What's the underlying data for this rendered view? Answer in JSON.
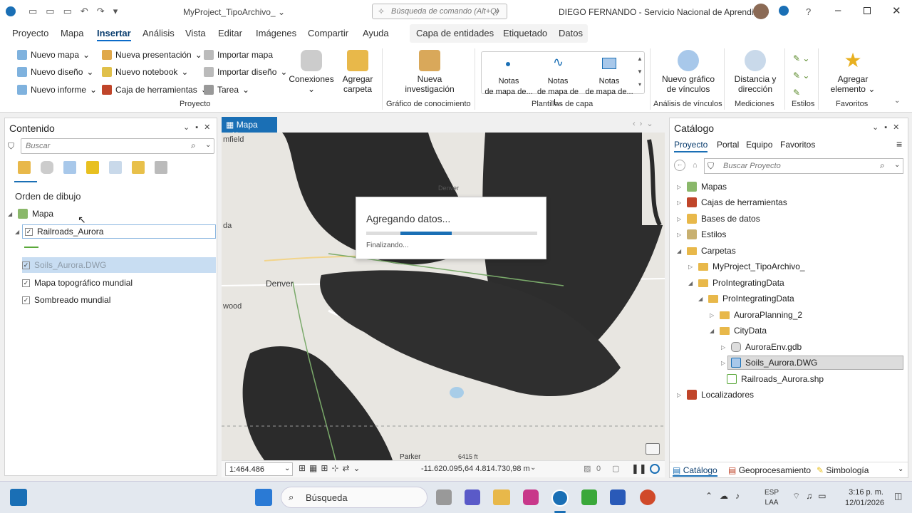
{
  "title": {
    "project": "MyProject_TipoArchivo_",
    "search_placeholder": "Búsqueda de comando (Alt+Q)",
    "user": "DIEGO FERNANDO - Servicio Nacional de Aprendizaje"
  },
  "tabs": [
    "Proyecto",
    "Mapa",
    "Insertar",
    "Análisis",
    "Vista",
    "Editar",
    "Imágenes",
    "Compartir",
    "Ayuda"
  ],
  "context_tabs": [
    "Capa de entidades",
    "Etiquetado",
    "Datos"
  ],
  "ribbon": {
    "proyecto": [
      "Nuevo mapa",
      "Nuevo diseño",
      "Nuevo informe",
      "Nueva presentación",
      "Nuevo notebook",
      "Caja de herramientas",
      "Importar mapa",
      "Importar diseño",
      "Tarea"
    ],
    "conexiones": "Conexiones",
    "agregar_carpeta": [
      "Agregar",
      "carpeta"
    ],
    "nueva_investigacion": [
      "Nueva",
      "investigación"
    ],
    "notas": [
      "Notas\nde mapa de...",
      "Notas\nde mapa de l...",
      "Notas\nde mapa de..."
    ],
    "nuevo_grafico": [
      "Nuevo gráfico",
      "de vínculos"
    ],
    "distancia": [
      "Distancia y",
      "dirección"
    ],
    "agregar_elemento": [
      "Agregar",
      "elemento"
    ],
    "groups": [
      "Proyecto",
      "Gráfico de conocimiento",
      "Plantillas de capa",
      "Análisis de vínculos",
      "Mediciones",
      "Estilos",
      "Favoritos"
    ]
  },
  "contents": {
    "title": "Contenido",
    "search_placeholder": "Buscar",
    "draw_order": "Orden de dibujo",
    "map": "Mapa",
    "layers": [
      "Railroads_Aurora",
      "Soils_Aurora.DWG",
      "Mapa topográfico mundial",
      "Sombreado mundial"
    ]
  },
  "map_view": {
    "tab": "Mapa",
    "labels": [
      "mfield",
      "da",
      "Denver",
      "wood",
      "Parker",
      "Denver"
    ],
    "dialog_title": "Agregando datos...",
    "dialog_status": "Finalizando...",
    "progress": 0.5,
    "elevation": "6415 ft",
    "scale": "1:464.486",
    "coords": "-11.620.095,64 4.814.730,98 m",
    "selected_count": "0"
  },
  "catalog": {
    "title": "Catálogo",
    "tabs": [
      "Proyecto",
      "Portal",
      "Equipo",
      "Favoritos"
    ],
    "search_placeholder": "Buscar Proyecto",
    "items": [
      "Mapas",
      "Cajas de herramientas",
      "Bases de datos",
      "Estilos",
      "Carpetas",
      "MyProject_TipoArchivo_",
      "ProIntegratingData",
      "ProIntegratingData",
      "AuroraPlanning_2",
      "CityData",
      "AuroraEnv.gdb",
      "Soils_Aurora.DWG",
      "Railroads_Aurora.shp",
      "Localizadores"
    ],
    "bottom_tabs": [
      "Catálogo",
      "Geoprocesamiento",
      "Simbología"
    ]
  },
  "taskbar": {
    "search": "Búsqueda",
    "lang1": "ESP",
    "lang2": "LAA",
    "time": "3:16 p. m.",
    "date": "12/01/2026"
  }
}
